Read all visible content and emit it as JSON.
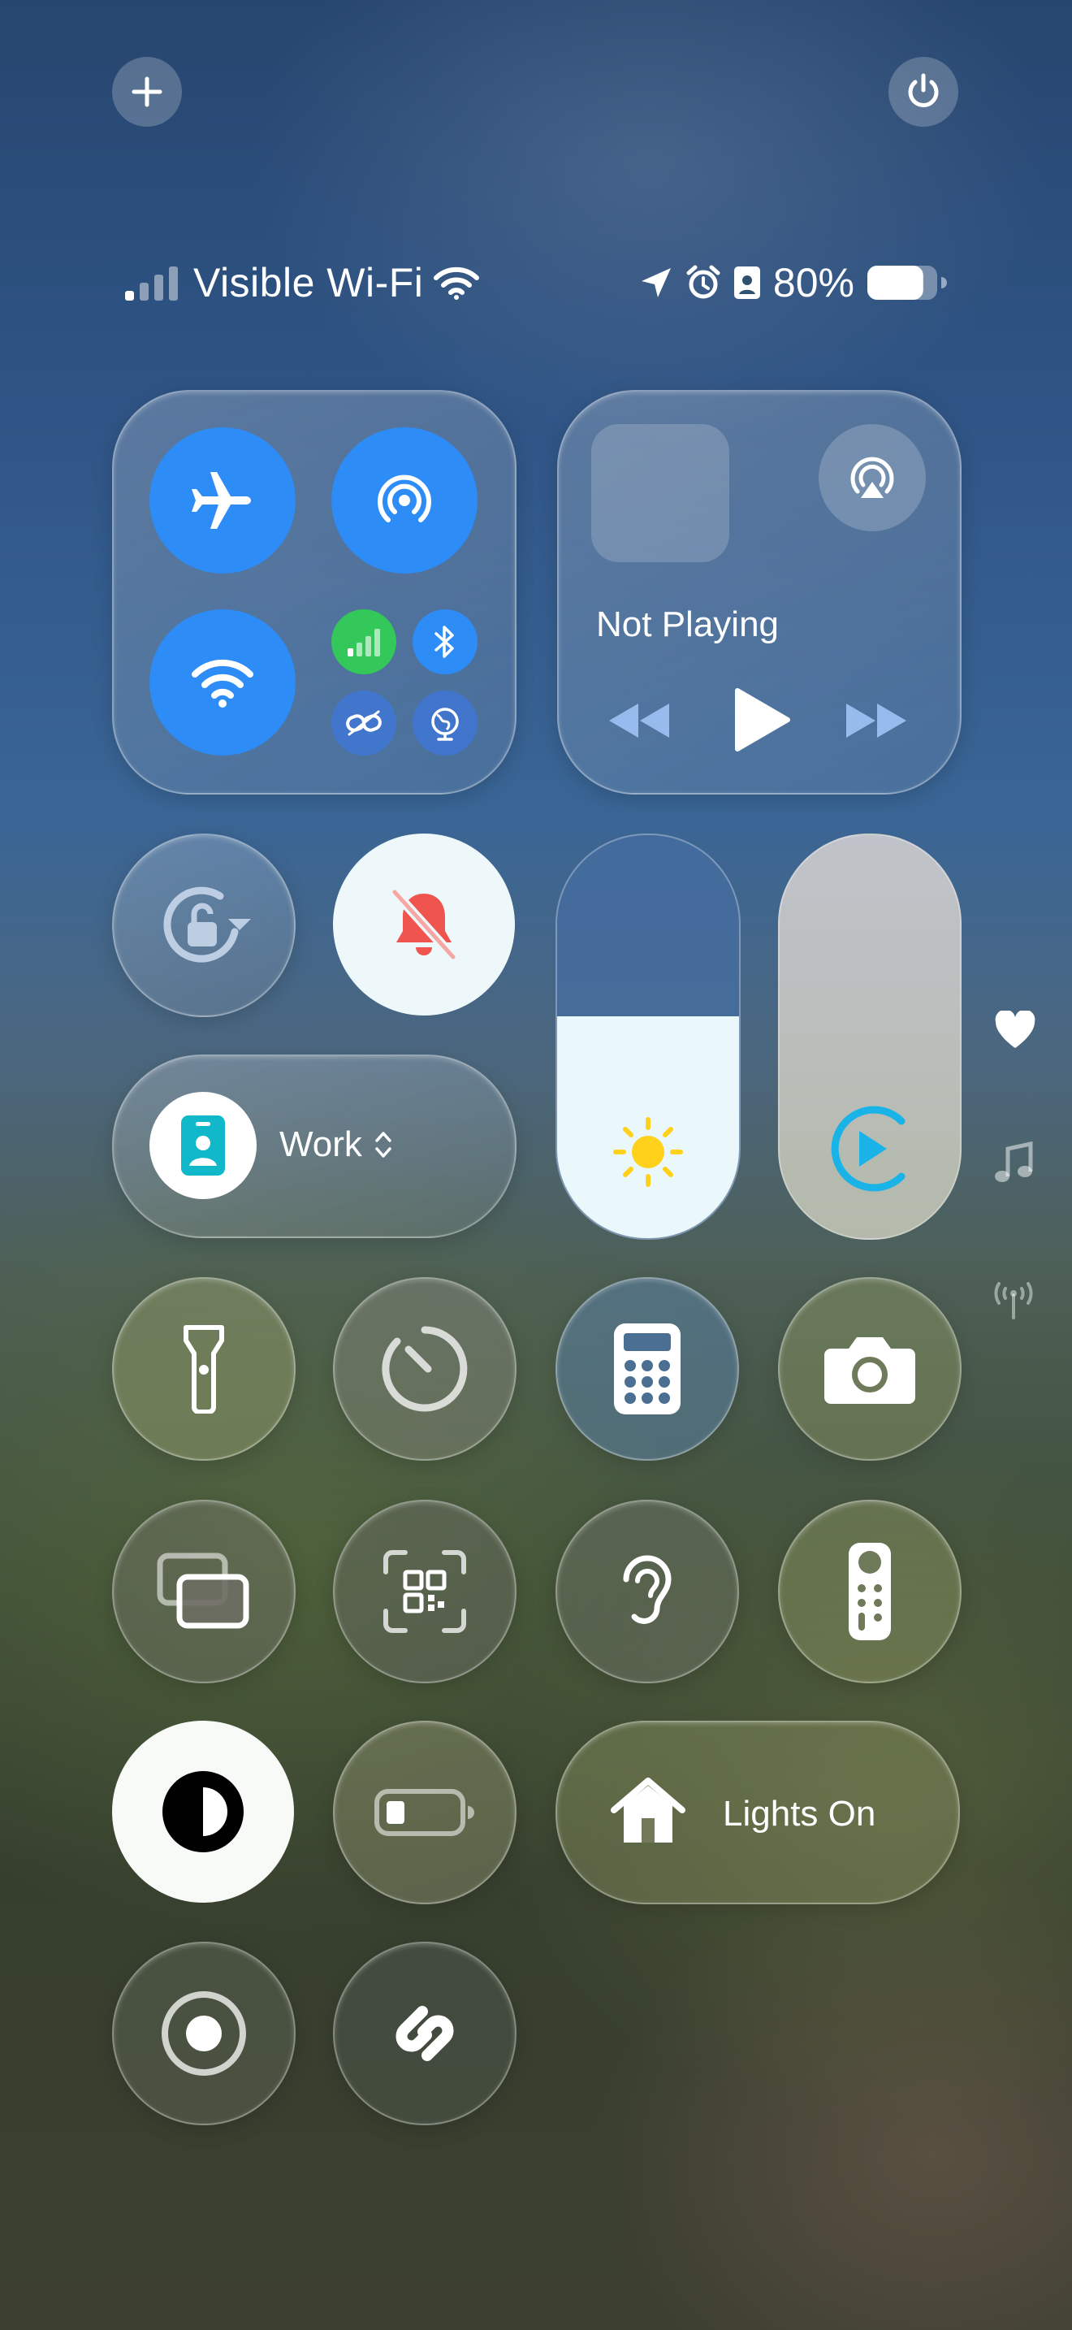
{
  "status_bar": {
    "carrier": "Visible Wi-Fi",
    "battery_percent": "80%",
    "battery_level": 0.8,
    "icons": [
      "signal-bars-icon",
      "wifi-icon",
      "location-arrow-icon",
      "alarm-icon",
      "focus-work-icon",
      "battery-icon"
    ]
  },
  "top_buttons": {
    "add_icon": "plus-icon",
    "power_icon": "power-icon"
  },
  "connectivity": {
    "airplane_mode": "airplane-icon",
    "airdrop": "airdrop-icon",
    "wifi": "wifi-icon",
    "cellular": "cellular-icon",
    "bluetooth": "bluetooth-icon",
    "hotspot": "link-icon",
    "vpn": "globe-icon",
    "colors": {
      "active_blue": "#2d8cf6",
      "cellular_green": "#34c759"
    }
  },
  "now_playing": {
    "title": "Not Playing",
    "controls": [
      "rewind-icon",
      "play-icon",
      "fast-forward-icon"
    ],
    "airplay": "airplay-icon"
  },
  "orientation_lock": {
    "icon": "orientation-lock-icon"
  },
  "silent_mode": {
    "icon": "bell-slash-icon",
    "color": "#f0544f"
  },
  "focus": {
    "label": "Work",
    "icon": "work-badge-icon",
    "color": "#11b8c9"
  },
  "brightness": {
    "level": 0.55,
    "icon": "sun-icon"
  },
  "volume": {
    "icon": "audio-play-icon"
  },
  "side_indicators": [
    "heart-icon",
    "music-note-icon",
    "antenna-icon"
  ],
  "tiles_row1": [
    "flashlight-icon",
    "timer-icon",
    "calculator-icon",
    "camera-icon"
  ],
  "tiles_row2": [
    "screen-mirroring-icon",
    "qr-code-icon",
    "hearing-icon",
    "remote-icon"
  ],
  "dark_mode": {
    "icon": "dark-mode-icon"
  },
  "low_power": {
    "icon": "low-power-battery-icon"
  },
  "home_scene": {
    "label": "Lights On",
    "icon": "house-icon"
  },
  "tiles_row4": [
    "screen-record-icon",
    "shazam-icon"
  ]
}
